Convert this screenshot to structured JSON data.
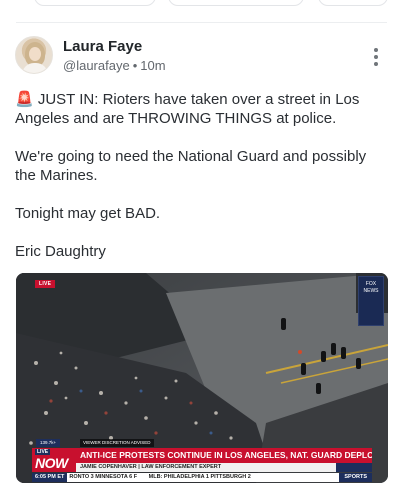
{
  "post": {
    "author_name": "Laura Faye",
    "handle": "@laurafaye",
    "separator": "•",
    "time_ago": "10m",
    "lines": [
      "🚨 JUST IN: Rioters have taken over a street in Los Angeles and are THROWING THINGS at police.",
      "We're going to need the National Guard and possibly the Marines.",
      "Tonight may get BAD.",
      "Eric Daughtry"
    ]
  },
  "video": {
    "live_tag": "LIVE",
    "logo_text": "FOX NEWS",
    "views": "139.7k+",
    "viewer_discretion": "VIEWER DISCRETION ADVISED",
    "live_badge": "LIVE",
    "now_text": "NOW",
    "headline": "ANTI-ICE PROTESTS CONTINUE IN LOS ANGELES, NAT. GUARD DEPLOYED",
    "subhead": "JAMIE COPENHAVER | LAW ENFORCEMENT EXPERT",
    "ticker_time": "6:05 PM ET",
    "ticker_items": "RONTO 3  MINNESOTA 6  F",
    "ticker_items2": "MLB: PHILADELPHIA 1  PITTSBURGH 2",
    "ticker_sports": "SPORTS"
  },
  "colors": {
    "accent_red": "#c8102e",
    "navy": "#1d2e5c",
    "text": "#2a2e33",
    "muted": "#63686e"
  },
  "icons": [
    "siren-icon",
    "more-options-icon",
    "avatar"
  ]
}
